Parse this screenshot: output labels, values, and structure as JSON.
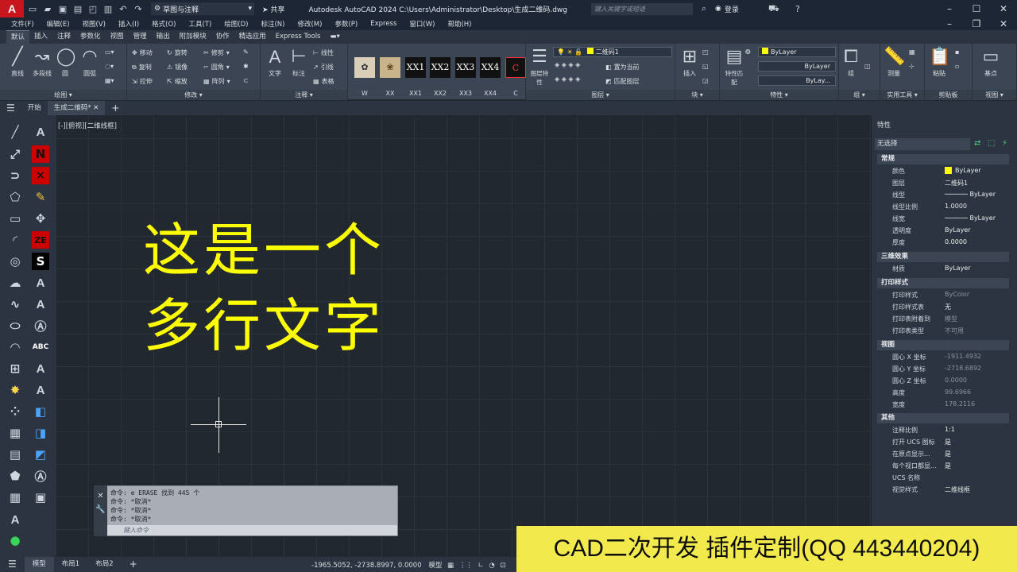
{
  "app": {
    "logo_letter": "A",
    "workspace": "草图与注释",
    "share": "共享",
    "title": "Autodesk AutoCAD 2024    C:\\Users\\Administrator\\Desktop\\生成二维码.dwg",
    "search_placeholder": "键入关键字或短语",
    "login": "登录"
  },
  "menus": [
    "文件(F)",
    "编辑(E)",
    "视图(V)",
    "插入(I)",
    "格式(O)",
    "工具(T)",
    "绘图(D)",
    "标注(N)",
    "修改(M)",
    "参数(P)",
    "Express",
    "窗口(W)",
    "帮助(H)"
  ],
  "ribbon_tabs": [
    "默认",
    "插入",
    "注释",
    "参数化",
    "视图",
    "管理",
    "输出",
    "附加模块",
    "协作",
    "精选应用",
    "Express Tools"
  ],
  "ribbon": {
    "draw": {
      "label": "绘图",
      "line": "直线",
      "pline": "多段线",
      "circle": "圆",
      "arc": "圆弧"
    },
    "modify": {
      "label": "修改",
      "move": "移动",
      "rotate": "旋转",
      "trim": "修剪",
      "copy": "复制",
      "mirror": "镜像",
      "fillet": "圆角",
      "stretch": "拉伸",
      "scale": "缩放",
      "array": "阵列"
    },
    "annotation": {
      "label": "注释",
      "text": "文字",
      "dim": "标注",
      "linear": "线性",
      "leader": "引线",
      "table": "表格"
    },
    "blocks": [
      "W",
      "XX",
      "XX1",
      "XX2",
      "XX3",
      "XX4",
      "C"
    ],
    "block_tiles": [
      "XX1",
      "XX2",
      "XX3",
      "XX4",
      "C"
    ],
    "layers": {
      "label": "图层",
      "props": "图层特性",
      "current_layer": "二维码1",
      "set_current": "置为当前",
      "match": "匹配图层"
    },
    "block": {
      "label": "块",
      "insert": "插入"
    },
    "properties": {
      "label": "特性",
      "match": "特性匹配",
      "color": "ByLayer",
      "linetype": "ByLayer",
      "lineweight": "ByLay..."
    },
    "groups": {
      "label": "组",
      "group": "组"
    },
    "utilities": {
      "label": "实用工具",
      "measure": "测量"
    },
    "clipboard": {
      "label": "剪贴板",
      "paste": "粘贴"
    },
    "view": {
      "label": "视图",
      "base": "基点"
    }
  },
  "doctabs": {
    "start": "开始",
    "drawing": "生成二维码*"
  },
  "viewport_label": "[-][俯视][二维线框]",
  "mtext": {
    "line1": "这是一个",
    "line2": "多行文字"
  },
  "command": {
    "lines": [
      "命令: e ERASE 找到 445 个",
      "命令: *取消*",
      "命令: *取消*",
      "命令: *取消*"
    ],
    "placeholder": "键入命令"
  },
  "properties": {
    "title": "特性",
    "selection": "无选择",
    "sections": {
      "general": "常规",
      "3d": "三维效果",
      "plot": "打印样式",
      "view": "视图",
      "misc": "其他"
    },
    "general": [
      {
        "k": "颜色",
        "v": "ByLayer"
      },
      {
        "k": "图层",
        "v": "二维码1"
      },
      {
        "k": "线型",
        "v": "ByLayer"
      },
      {
        "k": "线型比例",
        "v": "1.0000"
      },
      {
        "k": "线宽",
        "v": "ByLayer"
      },
      {
        "k": "透明度",
        "v": "ByLayer"
      },
      {
        "k": "厚度",
        "v": "0.0000"
      }
    ],
    "material": {
      "k": "材质",
      "v": "ByLayer"
    },
    "plot": [
      {
        "k": "打印样式",
        "v": "ByColor"
      },
      {
        "k": "打印样式表",
        "v": "无"
      },
      {
        "k": "打印表附着到",
        "v": "模型"
      },
      {
        "k": "打印表类型",
        "v": "不可用"
      }
    ],
    "view": [
      {
        "k": "圆心 X 坐标",
        "v": "-1911.4932"
      },
      {
        "k": "圆心 Y 坐标",
        "v": "-2718.6892"
      },
      {
        "k": "圆心 Z 坐标",
        "v": "0.0000"
      },
      {
        "k": "高度",
        "v": "99.6966"
      },
      {
        "k": "宽度",
        "v": "178.2116"
      }
    ],
    "misc": [
      {
        "k": "注释比例",
        "v": "1:1"
      },
      {
        "k": "打开 UCS 图标",
        "v": "是"
      },
      {
        "k": "在原点显示...",
        "v": "是"
      },
      {
        "k": "每个视口都显...",
        "v": "是"
      },
      {
        "k": "UCS 名称",
        "v": ""
      },
      {
        "k": "视觉样式",
        "v": "二维线框"
      }
    ]
  },
  "status": {
    "model": "模型",
    "layout1": "布局1",
    "layout2": "布局2",
    "coords": "-1965.5052, -2738.8997, 0.0000",
    "mode": "模型"
  },
  "banner": "CAD二次开发 插件定制(QQ 443440204)",
  "colors": {
    "text_yellow": "#ffff00",
    "banner_bg": "#f2e94d",
    "canvas_bg": "#212830"
  }
}
